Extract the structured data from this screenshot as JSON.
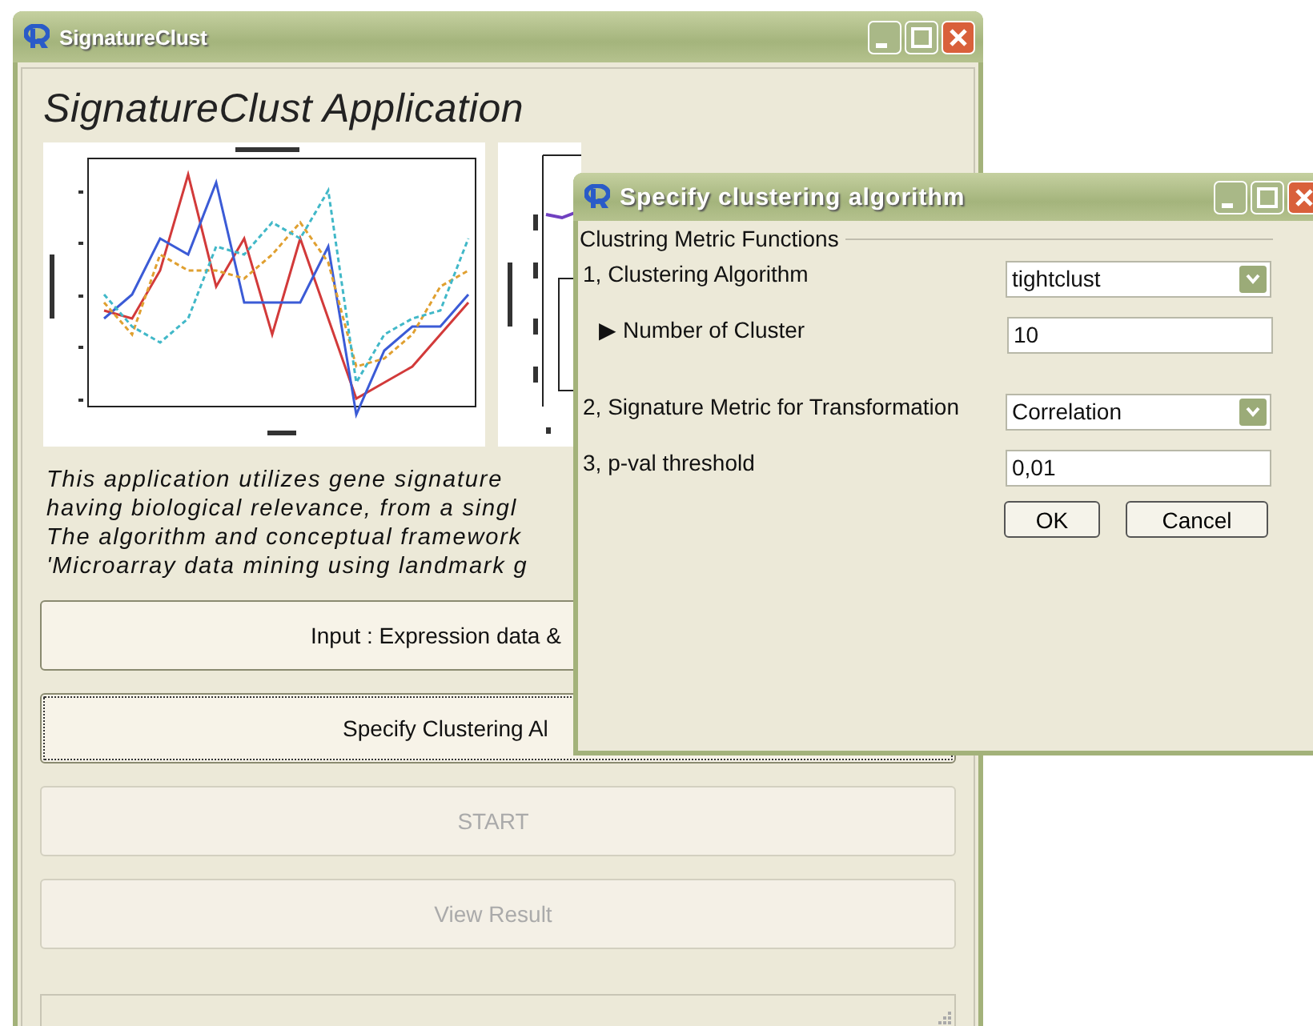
{
  "main_window": {
    "title": "SignatureClust",
    "heading": "SignatureClust Application",
    "description_lines": [
      "This application utilizes gene signature",
      "having biological relevance, from a singl",
      "The algorithm and conceptual framework",
      "'Microarray data mining using landmark g"
    ],
    "buttons": [
      {
        "label": "Input : Expression data &",
        "enabled": true,
        "focused": false
      },
      {
        "label": "Specify Clustering Al",
        "enabled": true,
        "focused": true
      },
      {
        "label": "START",
        "enabled": false,
        "focused": false
      },
      {
        "label": "View Result",
        "enabled": false,
        "focused": false
      }
    ]
  },
  "dialog": {
    "title": "Specify clustering algorithm",
    "group_label": "Clustring Metric Functions",
    "fields": [
      {
        "kind": "dropdown",
        "label": "1, Clustering Algorithm",
        "value": "tightclust"
      },
      {
        "kind": "text",
        "marker": "▶",
        "label": "Number of Cluster",
        "value": "10"
      },
      {
        "kind": "dropdown",
        "label": "2, Signature Metric for Transformation",
        "value": "Correlation"
      },
      {
        "kind": "text",
        "label": "3, p-val threshold",
        "value": "0,01"
      }
    ],
    "buttons": [
      "OK",
      "Cancel"
    ]
  }
}
